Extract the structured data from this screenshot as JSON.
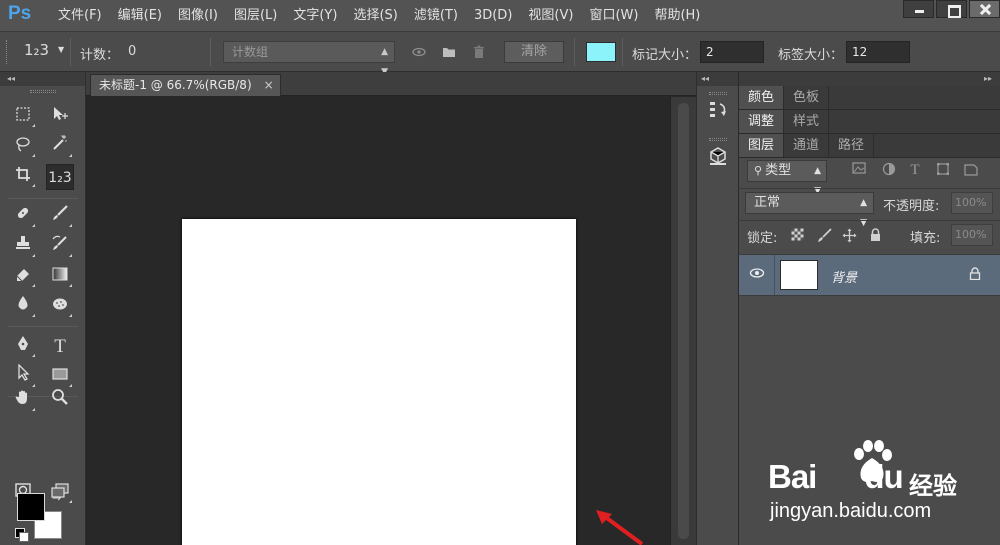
{
  "app": {
    "logo": "Ps"
  },
  "menu": [
    "文件(F)",
    "编辑(E)",
    "图像(I)",
    "图层(L)",
    "文字(Y)",
    "选择(S)",
    "滤镜(T)",
    "3D(D)",
    "视图(V)",
    "窗口(W)",
    "帮助(H)"
  ],
  "options_bar": {
    "tool_label": "1₂3",
    "count_label": "计数：",
    "count_value": "0",
    "count_group_placeholder": "计数组",
    "clear_label": "清除",
    "swatch_color": "#8df3fb",
    "marker_size_label": "标记大小：",
    "marker_size_value": "2",
    "label_size_label": "标签大小：",
    "label_size_value": "12"
  },
  "document": {
    "tab_title": "未标题-1 @ 66.7%(RGB/8)",
    "close_glyph": "×"
  },
  "tools": {
    "count_tool_glyph": "1₂3",
    "type_tool_glyph": "T"
  },
  "panels": {
    "group1": {
      "tabs": [
        "颜色",
        "色板"
      ]
    },
    "group2": {
      "tabs": [
        "调整",
        "样式"
      ]
    },
    "group3": {
      "tabs": [
        "图层",
        "通道",
        "路径"
      ]
    }
  },
  "layers": {
    "filter_kind": "类型",
    "blend_mode": "正常",
    "opacity_label": "不透明度:",
    "opacity_value": "100%",
    "lock_label": "锁定:",
    "fill_label": "填充:",
    "fill_value": "100%",
    "items": [
      {
        "name": "背景"
      }
    ]
  },
  "watermark": {
    "brand_text": "Bai",
    "brand_text2": "du",
    "brand_cn": "经验",
    "url": "jingyan.baidu.com"
  },
  "colors": {
    "layer_selected": "#5b6b7c",
    "annotation_arrow": "#e02020"
  }
}
